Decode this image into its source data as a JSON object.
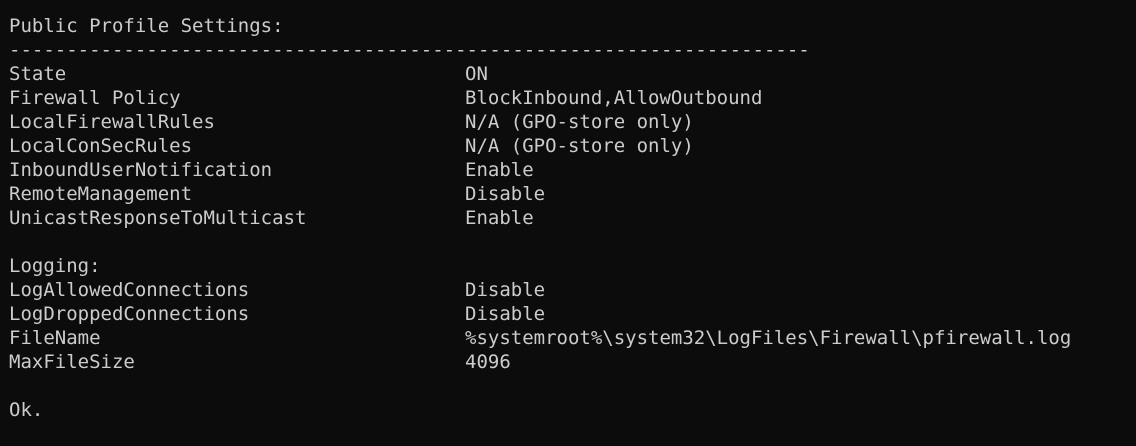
{
  "terminal": {
    "header": "Public Profile Settings:",
    "separator": "----------------------------------------------------------------------",
    "settings": [
      {
        "key": "State",
        "value": "ON"
      },
      {
        "key": "Firewall Policy",
        "value": "BlockInbound,AllowOutbound"
      },
      {
        "key": "LocalFirewallRules",
        "value": "N/A (GPO-store only)"
      },
      {
        "key": "LocalConSecRules",
        "value": "N/A (GPO-store only)"
      },
      {
        "key": "InboundUserNotification",
        "value": "Enable"
      },
      {
        "key": "RemoteManagement",
        "value": "Disable"
      },
      {
        "key": "UnicastResponseToMulticast",
        "value": "Enable"
      }
    ],
    "logging_header": "Logging:",
    "logging": [
      {
        "key": "LogAllowedConnections",
        "value": "Disable"
      },
      {
        "key": "LogDroppedConnections",
        "value": "Disable"
      },
      {
        "key": "FileName",
        "value": "%systemroot%\\system32\\LogFiles\\Firewall\\pfirewall.log"
      },
      {
        "key": "MaxFileSize",
        "value": "4096"
      }
    ],
    "status": "Ok."
  },
  "colors": {
    "background": "#0c0c0c",
    "text": "#cccccc"
  }
}
